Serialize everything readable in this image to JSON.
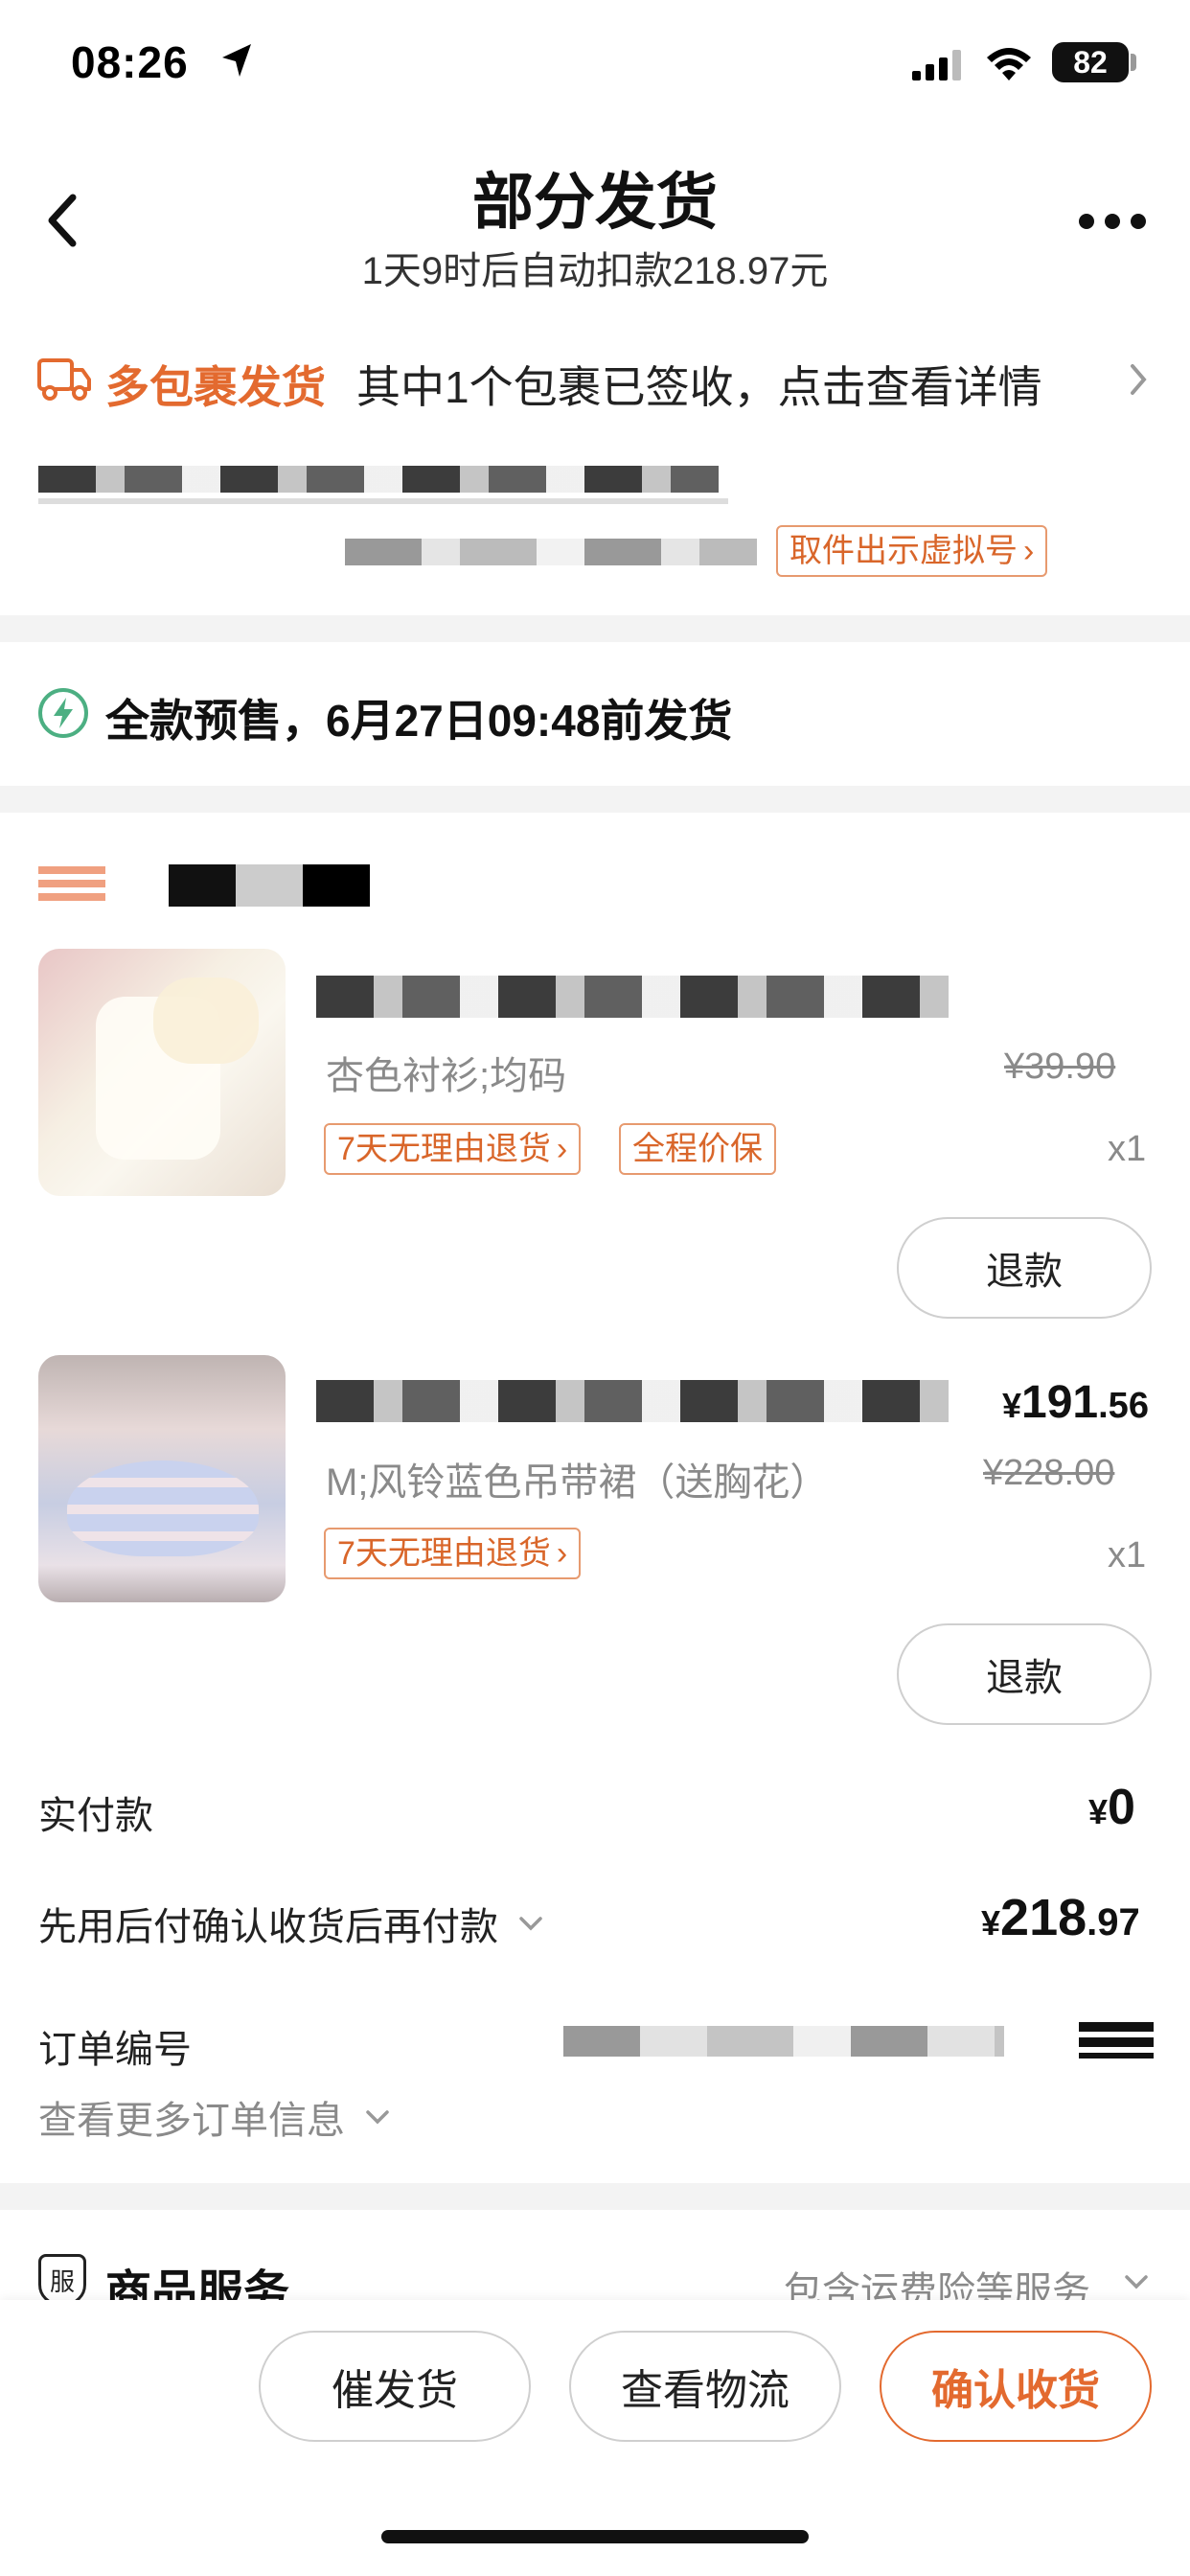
{
  "status_bar": {
    "time": "08:26",
    "battery": "82"
  },
  "header": {
    "title": "部分发货",
    "subtitle": "1天9时后自动扣款218.97元"
  },
  "shipping": {
    "label": "多包裹发货",
    "text": "其中1个包裹已签收，点击查看详情",
    "pickup_tag": "取件出示虚拟号"
  },
  "presale": {
    "text": "全款预售，6月27日09:48前发货"
  },
  "items": [
    {
      "variant": "杏色衬衫;均码",
      "original_price": "¥39.90",
      "tags": [
        "7天无理由退货",
        "全程价保"
      ],
      "qty": "x1",
      "refund_label": "退款"
    },
    {
      "price_symbol": "¥",
      "price_int": "191",
      "price_dec": ".56",
      "variant": "M;风铃蓝色吊带裙（送胸花）",
      "original_price": "¥228.00",
      "tags": [
        "7天无理由退货"
      ],
      "qty": "x1",
      "refund_label": "退款"
    }
  ],
  "summary": {
    "paid_label": "实付款",
    "paid_symbol": "¥",
    "paid_value": "0",
    "later_label": "先用后付确认收货后再付款",
    "later_symbol": "¥",
    "later_int": "218",
    "later_dec": ".97",
    "order_no_label": "订单编号",
    "more_info": "查看更多订单信息"
  },
  "service": {
    "icon_char": "服",
    "title": "商品服务",
    "desc": "包含运费险等服务"
  },
  "bottom_bar": {
    "urge": "催发货",
    "logistics": "查看物流",
    "confirm": "确认收货"
  },
  "colors": {
    "accent": "#e36a2f",
    "muted": "#8a8a8a",
    "band": "#f3f3f3",
    "green": "#4caf82"
  }
}
